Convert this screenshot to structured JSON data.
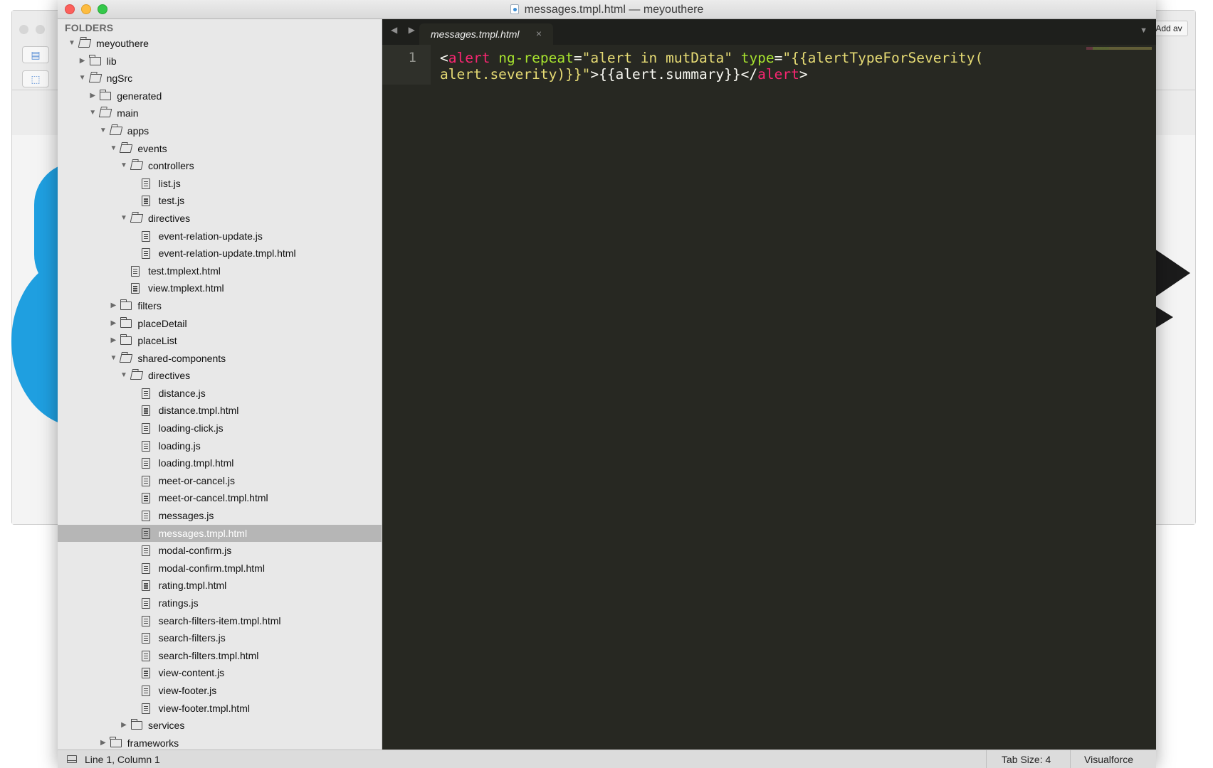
{
  "window": {
    "title": "messages.tmpl.html — meyouthere"
  },
  "background_app": {
    "right_button": "Add av"
  },
  "sidebar": {
    "heading": "FOLDERS",
    "tree": [
      {
        "label": "meyouthere",
        "type": "folder",
        "depth": 0,
        "expanded": true
      },
      {
        "label": "lib",
        "type": "folder",
        "depth": 1,
        "expanded": false
      },
      {
        "label": "ngSrc",
        "type": "folder",
        "depth": 1,
        "expanded": true
      },
      {
        "label": "generated",
        "type": "folder",
        "depth": 2,
        "expanded": false
      },
      {
        "label": "main",
        "type": "folder",
        "depth": 2,
        "expanded": true
      },
      {
        "label": "apps",
        "type": "folder",
        "depth": 3,
        "expanded": true
      },
      {
        "label": "events",
        "type": "folder",
        "depth": 4,
        "expanded": true
      },
      {
        "label": "controllers",
        "type": "folder",
        "depth": 5,
        "expanded": true
      },
      {
        "label": "list.js",
        "type": "file",
        "depth": 6
      },
      {
        "label": "test.js",
        "type": "file",
        "depth": 6
      },
      {
        "label": "directives",
        "type": "folder",
        "depth": 5,
        "expanded": true
      },
      {
        "label": "event-relation-update.js",
        "type": "file",
        "depth": 6
      },
      {
        "label": "event-relation-update.tmpl.html",
        "type": "file",
        "depth": 6
      },
      {
        "label": "test.tmplext.html",
        "type": "file",
        "depth": 5
      },
      {
        "label": "view.tmplext.html",
        "type": "file",
        "depth": 5
      },
      {
        "label": "filters",
        "type": "folder",
        "depth": 4,
        "expanded": false
      },
      {
        "label": "placeDetail",
        "type": "folder",
        "depth": 4,
        "expanded": false
      },
      {
        "label": "placeList",
        "type": "folder",
        "depth": 4,
        "expanded": false
      },
      {
        "label": "shared-components",
        "type": "folder",
        "depth": 4,
        "expanded": true
      },
      {
        "label": "directives",
        "type": "folder",
        "depth": 5,
        "expanded": true
      },
      {
        "label": "distance.js",
        "type": "file",
        "depth": 6
      },
      {
        "label": "distance.tmpl.html",
        "type": "file",
        "depth": 6
      },
      {
        "label": "loading-click.js",
        "type": "file",
        "depth": 6
      },
      {
        "label": "loading.js",
        "type": "file",
        "depth": 6
      },
      {
        "label": "loading.tmpl.html",
        "type": "file",
        "depth": 6
      },
      {
        "label": "meet-or-cancel.js",
        "type": "file",
        "depth": 6
      },
      {
        "label": "meet-or-cancel.tmpl.html",
        "type": "file",
        "depth": 6
      },
      {
        "label": "messages.js",
        "type": "file",
        "depth": 6
      },
      {
        "label": "messages.tmpl.html",
        "type": "file",
        "depth": 6,
        "selected": true
      },
      {
        "label": "modal-confirm.js",
        "type": "file",
        "depth": 6
      },
      {
        "label": "modal-confirm.tmpl.html",
        "type": "file",
        "depth": 6
      },
      {
        "label": "rating.tmpl.html",
        "type": "file",
        "depth": 6
      },
      {
        "label": "ratings.js",
        "type": "file",
        "depth": 6
      },
      {
        "label": "search-filters-item.tmpl.html",
        "type": "file",
        "depth": 6
      },
      {
        "label": "search-filters.js",
        "type": "file",
        "depth": 6
      },
      {
        "label": "search-filters.tmpl.html",
        "type": "file",
        "depth": 6
      },
      {
        "label": "view-content.js",
        "type": "file",
        "depth": 6
      },
      {
        "label": "view-footer.js",
        "type": "file",
        "depth": 6
      },
      {
        "label": "view-footer.tmpl.html",
        "type": "file",
        "depth": 6
      },
      {
        "label": "services",
        "type": "folder",
        "depth": 5,
        "expanded": false
      },
      {
        "label": "frameworks",
        "type": "folder",
        "depth": 3,
        "expanded": false
      }
    ]
  },
  "tabs": [
    {
      "label": "messages.tmpl.html",
      "active": true,
      "close_glyph": "×"
    }
  ],
  "tabbar": {
    "nav_glyphs": "◀ ▶",
    "menu_glyph": "▼"
  },
  "editor": {
    "line_number": "1",
    "code": {
      "l1_open": "<",
      "l1_tag": "alert",
      "l1_sp1": " ",
      "l1_attr1": "ng-repeat",
      "l1_eq1": "=",
      "l1_val1": "\"alert in mutData\"",
      "l1_sp2": " ",
      "l1_attr2": "type",
      "l1_eq2": "=",
      "l1_val2": "\"{{alertTypeForSeverity(",
      "l2_val": "alert.severity)}}\"",
      "l2_text": ">{{alert.summary}}</",
      "l2_tag": "alert",
      "l2_close": ">"
    }
  },
  "statusbar": {
    "position": "Line 1, Column 1",
    "tab_size": "Tab Size: 4",
    "syntax": "Visualforce"
  },
  "colors": {
    "editor_bg": "#272822",
    "tag": "#f92672",
    "attribute": "#a6e22e",
    "string": "#e6db74",
    "selection": "#b6b6b6"
  }
}
